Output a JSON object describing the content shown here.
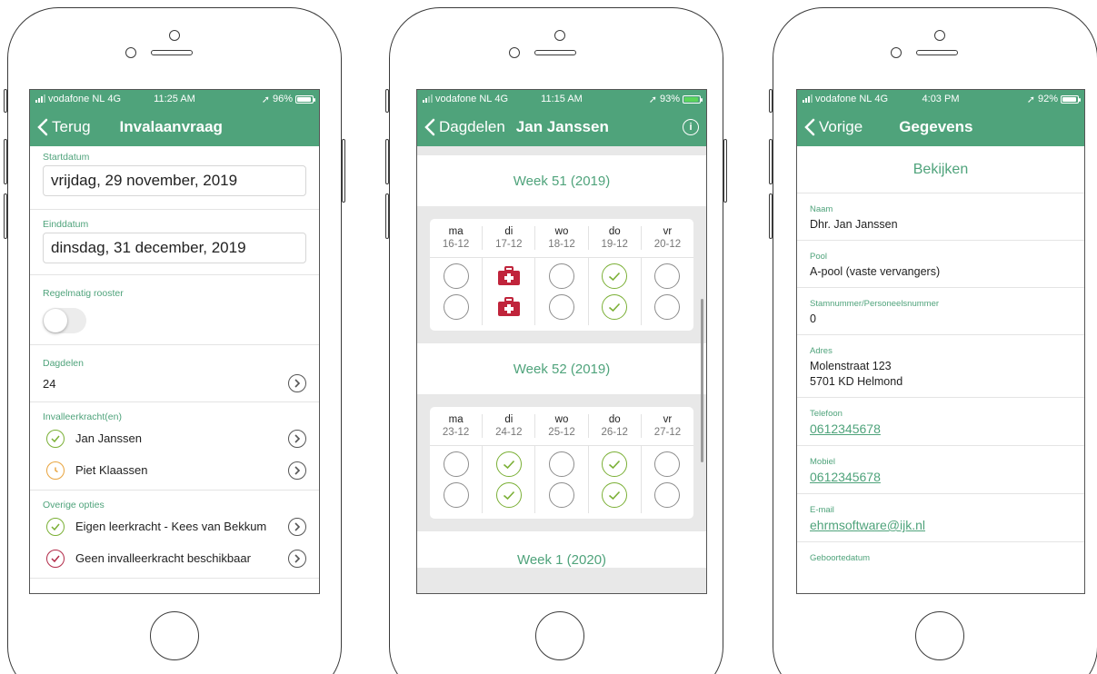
{
  "status": {
    "carrier": "vodafone NL",
    "network": "4G"
  },
  "screen1": {
    "time": "11:25 AM",
    "battery": "96%",
    "back_label": "Terug",
    "title": "Invalaanvraag",
    "startdatum_label": "Startdatum",
    "startdatum_value": "vrijdag, 29 november, 2019",
    "einddatum_label": "Einddatum",
    "einddatum_value": "dinsdag, 31 december, 2019",
    "regelmatig_label": "Regelmatig rooster",
    "regelmatig_on": false,
    "dagdelen_label": "Dagdelen",
    "dagdelen_value": "24",
    "invaller_label": "Invalleerkracht(en)",
    "invallers": [
      {
        "name": "Jan Janssen",
        "status": "check",
        "color": "#7bb036"
      },
      {
        "name": "Piet Klaassen",
        "status": "clock",
        "color": "#e8a33c"
      }
    ],
    "overige_label": "Overige opties",
    "overige": [
      {
        "name": "Eigen leerkracht - Kees van Bekkum",
        "status": "check",
        "color": "#7bb036"
      },
      {
        "name": "Geen invalleerkracht beschikbaar",
        "status": "check",
        "color": "#b22a48"
      }
    ]
  },
  "screen2": {
    "time": "11:15 AM",
    "battery": "93%",
    "back_label": "Dagdelen",
    "title": "Jan Janssen",
    "info_glyph": "i",
    "weeks": [
      {
        "label": "Week 51 (2019)",
        "days": [
          {
            "name": "ma",
            "date": "16-12",
            "cells": [
              "empty",
              "empty"
            ]
          },
          {
            "name": "di",
            "date": "17-12",
            "cells": [
              "sick",
              "sick"
            ]
          },
          {
            "name": "wo",
            "date": "18-12",
            "cells": [
              "empty",
              "empty"
            ]
          },
          {
            "name": "do",
            "date": "19-12",
            "cells": [
              "check",
              "check"
            ]
          },
          {
            "name": "vr",
            "date": "20-12",
            "cells": [
              "empty",
              "empty"
            ]
          }
        ]
      },
      {
        "label": "Week 52 (2019)",
        "days": [
          {
            "name": "ma",
            "date": "23-12",
            "cells": [
              "empty",
              "empty"
            ]
          },
          {
            "name": "di",
            "date": "24-12",
            "cells": [
              "check",
              "check"
            ]
          },
          {
            "name": "wo",
            "date": "25-12",
            "cells": [
              "empty",
              "empty"
            ]
          },
          {
            "name": "do",
            "date": "26-12",
            "cells": [
              "check",
              "check"
            ]
          },
          {
            "name": "vr",
            "date": "27-12",
            "cells": [
              "empty",
              "empty"
            ]
          }
        ]
      }
    ],
    "next_week_label": "Week 1 (2020)",
    "colors": {
      "check": "#7bb036",
      "sick": "#c0243b",
      "empty": "#8e8e8e"
    }
  },
  "screen3": {
    "time": "4:03 PM",
    "battery": "92%",
    "back_label": "Vorige",
    "title": "Gegevens",
    "section_title": "Bekijken",
    "fields": {
      "naam_label": "Naam",
      "naam_value": "Dhr. Jan Janssen",
      "pool_label": "Pool",
      "pool_value": "A-pool (vaste vervangers)",
      "stamnummer_label": "Stamnummer/Personeelsnummer",
      "stamnummer_value": "0",
      "adres_label": "Adres",
      "adres_line1": "Molenstraat 123",
      "adres_line2": "5701 KD Helmond",
      "telefoon_label": "Telefoon",
      "telefoon_value": "0612345678",
      "mobiel_label": "Mobiel",
      "mobiel_value": "0612345678",
      "email_label": "E-mail",
      "email_value": "ehrmsoftware@ijk.nl",
      "geboortedatum_label": "Geboortedatum"
    }
  },
  "theme": {
    "primary": "#4fa37b"
  }
}
